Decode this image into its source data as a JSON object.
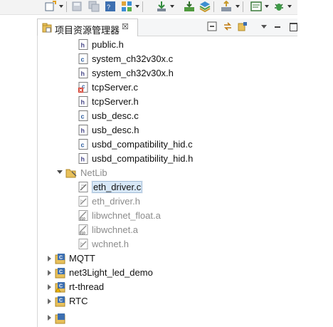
{
  "view": {
    "title": "项目资源管理器",
    "close_glyph": "☒"
  },
  "toolbar_icons": [
    "new-wizard-icon",
    "save-icon",
    "save-all-icon",
    "properties-icon",
    "build-icon",
    "download-icon",
    "build-all-icon",
    "layers-icon",
    "export-icon",
    "console-icon",
    "debug-bug-icon"
  ],
  "tree": {
    "files_top": [
      {
        "label": "public.h",
        "type": "h",
        "dim": false
      },
      {
        "label": "system_ch32v30x.c",
        "type": "c",
        "dim": false
      },
      {
        "label": "system_ch32v30x.h",
        "type": "h",
        "dim": false
      },
      {
        "label": "tcpServer.c",
        "type": "c-error",
        "dim": false
      },
      {
        "label": "tcpServer.h",
        "type": "h",
        "dim": false
      },
      {
        "label": "usb_desc.c",
        "type": "c",
        "dim": false
      },
      {
        "label": "usb_desc.h",
        "type": "h",
        "dim": false
      },
      {
        "label": "usbd_compatibility_hid.c",
        "type": "c",
        "dim": false
      },
      {
        "label": "usbd_compatibility_hid.h",
        "type": "h",
        "dim": false
      }
    ],
    "netlib_folder": {
      "label": "NetLib"
    },
    "netlib_files": [
      {
        "label": "eth_driver.c",
        "type": "excluded",
        "dim": false,
        "selected": true
      },
      {
        "label": "eth_driver.h",
        "type": "excluded",
        "dim": true
      },
      {
        "label": "libwchnet_float.a",
        "type": "excluded-lib",
        "dim": true
      },
      {
        "label": "libwchnet.a",
        "type": "excluded-lib",
        "dim": true
      },
      {
        "label": "wchnet.h",
        "type": "excluded",
        "dim": true
      }
    ],
    "projects": [
      {
        "label": "MQTT"
      },
      {
        "label": "net3Light_led_demo"
      },
      {
        "label": "rt-thread"
      },
      {
        "label": "RTC"
      }
    ]
  },
  "colors": {
    "selection_bg": "#d8e8f7",
    "dim_text": "#8c8c8c",
    "folder_yellow": "#e8c05a"
  }
}
